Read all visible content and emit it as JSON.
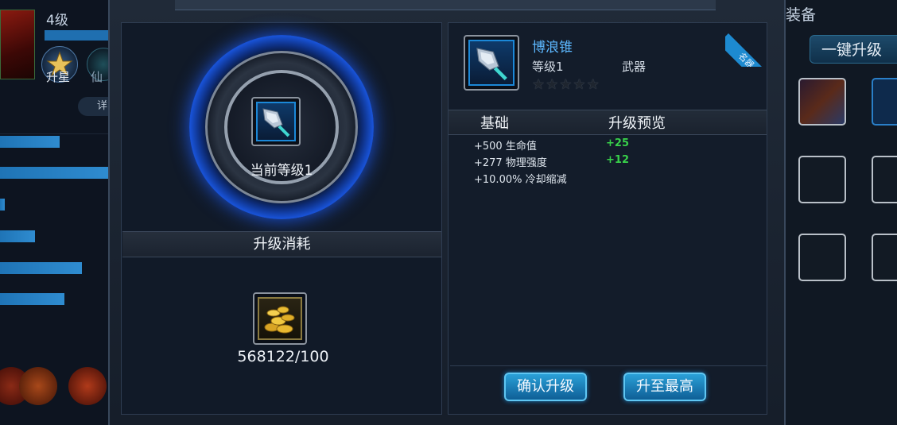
{
  "hero_bg": {
    "level": "4级",
    "star_label": "升星",
    "xian_label": "仙",
    "detail_tab": "详"
  },
  "equip_bg": {
    "title": "装备",
    "one_click": "一键升级"
  },
  "upgrade": {
    "current_level": "当前等级1",
    "cost_title": "升级消耗",
    "cost_amount": "568122/100"
  },
  "item": {
    "name": "博浪锥",
    "level": "等级1",
    "type": "武器",
    "badge": "名器",
    "stars_filled": 0,
    "stars_total": 5
  },
  "stats": {
    "col_base": "基础",
    "col_preview": "升级预览",
    "rows": [
      {
        "base": "+500 生命值",
        "inc": "+25"
      },
      {
        "base": "+277 物理强度",
        "inc": "+12"
      },
      {
        "base": "+10.00% 冷却缩减",
        "inc": ""
      }
    ]
  },
  "buttons": {
    "confirm": "确认升级",
    "max": "升至最高"
  },
  "colors": {
    "accent": "#1d8ad0",
    "increase": "#38d04a",
    "item_name": "#5cb8ff"
  },
  "icons": {
    "item": "spiked-mace-icon",
    "cost": "gold-coins-icon"
  }
}
